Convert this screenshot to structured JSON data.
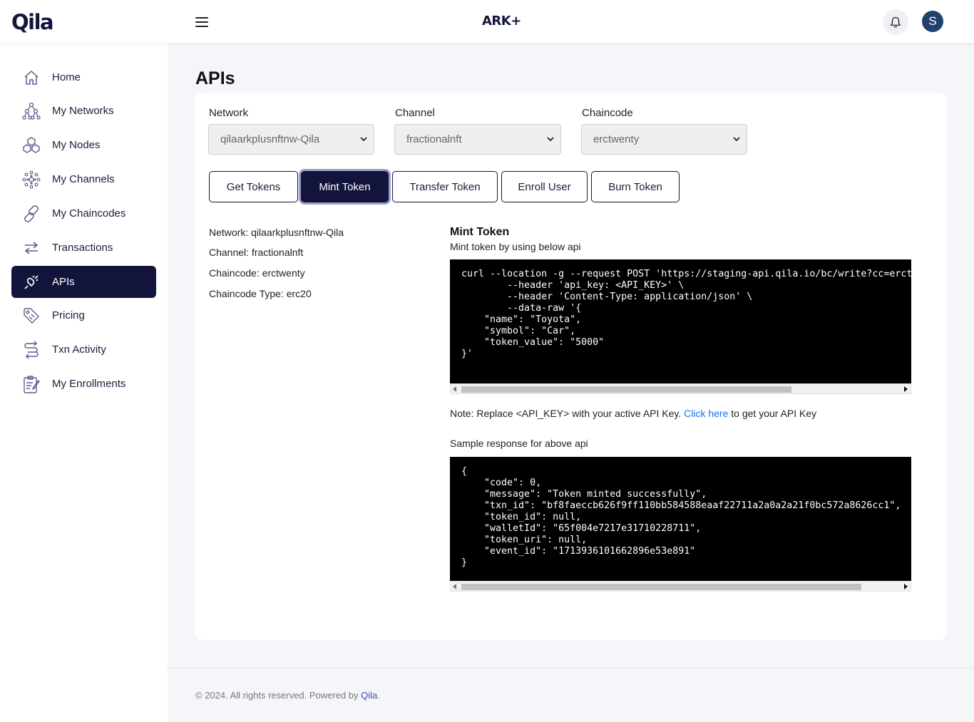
{
  "header": {
    "logo": "Qila",
    "brand": "ARK+",
    "avatar_initial": "S"
  },
  "sidebar": {
    "items": [
      {
        "label": "Home",
        "icon": "home-icon"
      },
      {
        "label": "My Networks",
        "icon": "network-icon"
      },
      {
        "label": "My Nodes",
        "icon": "nodes-icon"
      },
      {
        "label": "My Channels",
        "icon": "channels-icon"
      },
      {
        "label": "My Chaincodes",
        "icon": "chain-link-icon"
      },
      {
        "label": "Transactions",
        "icon": "transfer-arrows-icon"
      },
      {
        "label": "APIs",
        "icon": "plug-icon",
        "active": true
      },
      {
        "label": "Pricing",
        "icon": "price-tag-icon"
      },
      {
        "label": "Txn Activity",
        "icon": "activity-loop-icon"
      },
      {
        "label": "My Enrollments",
        "icon": "clipboard-icon"
      }
    ]
  },
  "page": {
    "title": "APIs"
  },
  "filters": {
    "network": {
      "label": "Network",
      "value": "qilaarkplusnftnw-Qila"
    },
    "channel": {
      "label": "Channel",
      "value": "fractionalnft"
    },
    "chaincode": {
      "label": "Chaincode",
      "value": "erctwenty"
    }
  },
  "actions": {
    "get_tokens": "Get Tokens",
    "mint_token": "Mint Token",
    "transfer_token": "Transfer Token",
    "enroll_user": "Enroll User",
    "burn_token": "Burn Token"
  },
  "info": {
    "network": "Network: qilaarkplusnftnw-Qila",
    "channel": "Channel: fractionalnft",
    "chaincode": "Chaincode: erctwenty",
    "chaincode_type": "Chaincode Type: erc20"
  },
  "api": {
    "title": "Mint Token",
    "subtitle": "Mint token by using below api",
    "request_code": "curl --location -g --request POST 'https://staging-api.qila.io/bc/write?cc=erctwenty&channel=fractionalnft&network=qilaarkplusnftnw-Qila' \\\n        --header 'api_key: <API_KEY>' \\\n        --header 'Content-Type: application/json' \\\n        --data-raw '{\n    \"name\": \"Toyota\",\n    \"symbol\": \"Car\",\n    \"token_value\": \"5000\"\n}'",
    "note_prefix": "Note: Replace <API_KEY> with your active API Key.",
    "note_link": "Click here",
    "note_suffix": "to get your API Key",
    "response_label": "Sample response for above api",
    "response_code": "{\n    \"code\": 0,\n    \"message\": \"Token minted successfully\",\n    \"txn_id\": \"bf8faeccb626f9ff110bb584588eaaf22711a2a0a2a21f0bc572a8626cc1",
    "response_code_rest": "\",\n    \"token_id\": null,\n    \"walletId\": \"65f004e7217e31710228711\",\n    \"token_uri\": null,\n    \"event_id\": \"1713936101662896e53e891\"\n}"
  },
  "footer": {
    "text": "© 2024. All rights reserved. Powered by",
    "link": "Qila",
    "end": "."
  }
}
